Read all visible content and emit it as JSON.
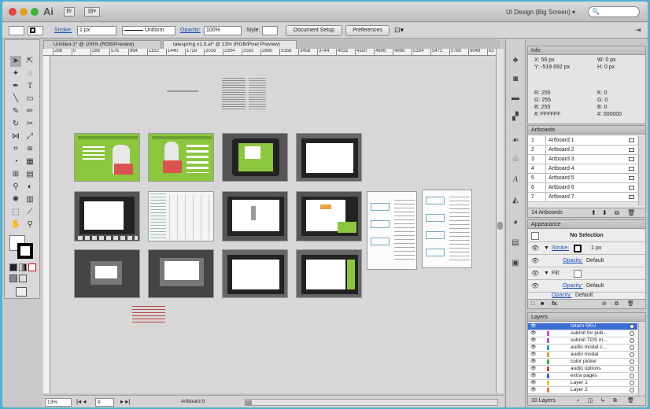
{
  "app": {
    "logo": "Ai",
    "workspace": "UI Design (Big Screen)",
    "workspace_arrow": "▾",
    "search_icon": "🔍",
    "br_label": "Br",
    "arr_label": "▤▾"
  },
  "control_bar": {
    "stroke_label": "Stroke:",
    "stroke_value": "1 px",
    "stroke_profile": "Uniform",
    "opacity_label": "Opacity:",
    "opacity_value": "100%",
    "style_label": "Style:",
    "document_setup": "Document Setup",
    "preferences": "Preferences"
  },
  "tabs": [
    {
      "label": "Untitled-1* @ 100% (RGB/Preview)"
    },
    {
      "label": "talespring v1.0.ai* @ 13% (RGB/Pixel Preview)"
    }
  ],
  "ruler": [
    "288",
    "0",
    "288",
    "576",
    "864",
    "1152",
    "1440",
    "1728",
    "2016",
    "2304",
    "2592",
    "2880",
    "3168",
    "3456",
    "3744",
    "4032",
    "4320",
    "4608",
    "4896",
    "5184",
    "5472",
    "5760",
    "6048",
    "63"
  ],
  "status": {
    "zoom": "13%",
    "artboard_num": "9",
    "artboard_label": "Artboard 9"
  },
  "info": {
    "title": "Info",
    "x": "X: 56 px",
    "y": "Y: -519.692 px",
    "w": "W: 0 px",
    "h": "H: 0 px",
    "r": "R: 255",
    "g": "G: 255",
    "b": "B: 255",
    "hex": "#: FFFFFF",
    "k": "K: 0",
    "g2": "G: 0",
    "b2": "B: 0",
    "hex2": "#: 000000"
  },
  "artboards": {
    "title": "Artboards",
    "items": [
      {
        "n": "1",
        "name": "Artboard 1"
      },
      {
        "n": "2",
        "name": "Artboard 2"
      },
      {
        "n": "3",
        "name": "Artboard 3"
      },
      {
        "n": "4",
        "name": "Artboard 4"
      },
      {
        "n": "5",
        "name": "Artboard 5"
      },
      {
        "n": "6",
        "name": "Artboard 6"
      },
      {
        "n": "7",
        "name": "Artboard 7"
      }
    ],
    "count": "14 Artboards"
  },
  "appearance": {
    "title": "Appearance",
    "selection": "No Selection",
    "stroke_label": "Stroke:",
    "stroke_value": "1 px",
    "opacity_label": "Opacity:",
    "opacity_value": "Default",
    "fill_label": "Fill:",
    "fx": "fx."
  },
  "layers": {
    "title": "Layers",
    "items": [
      {
        "name": "return SKU",
        "selected": true
      },
      {
        "name": "submit for pub...",
        "selected": false
      },
      {
        "name": "submit TOS m...",
        "selected": false
      },
      {
        "name": "audio modal c...",
        "selected": false
      },
      {
        "name": "audio modal",
        "selected": false
      },
      {
        "name": "color picker",
        "selected": false
      },
      {
        "name": "audio options",
        "selected": false
      },
      {
        "name": "extra pages",
        "selected": false
      },
      {
        "name": "Layer 1",
        "selected": false
      },
      {
        "name": "Layer 2",
        "selected": false
      }
    ],
    "count": "10 Layers"
  }
}
